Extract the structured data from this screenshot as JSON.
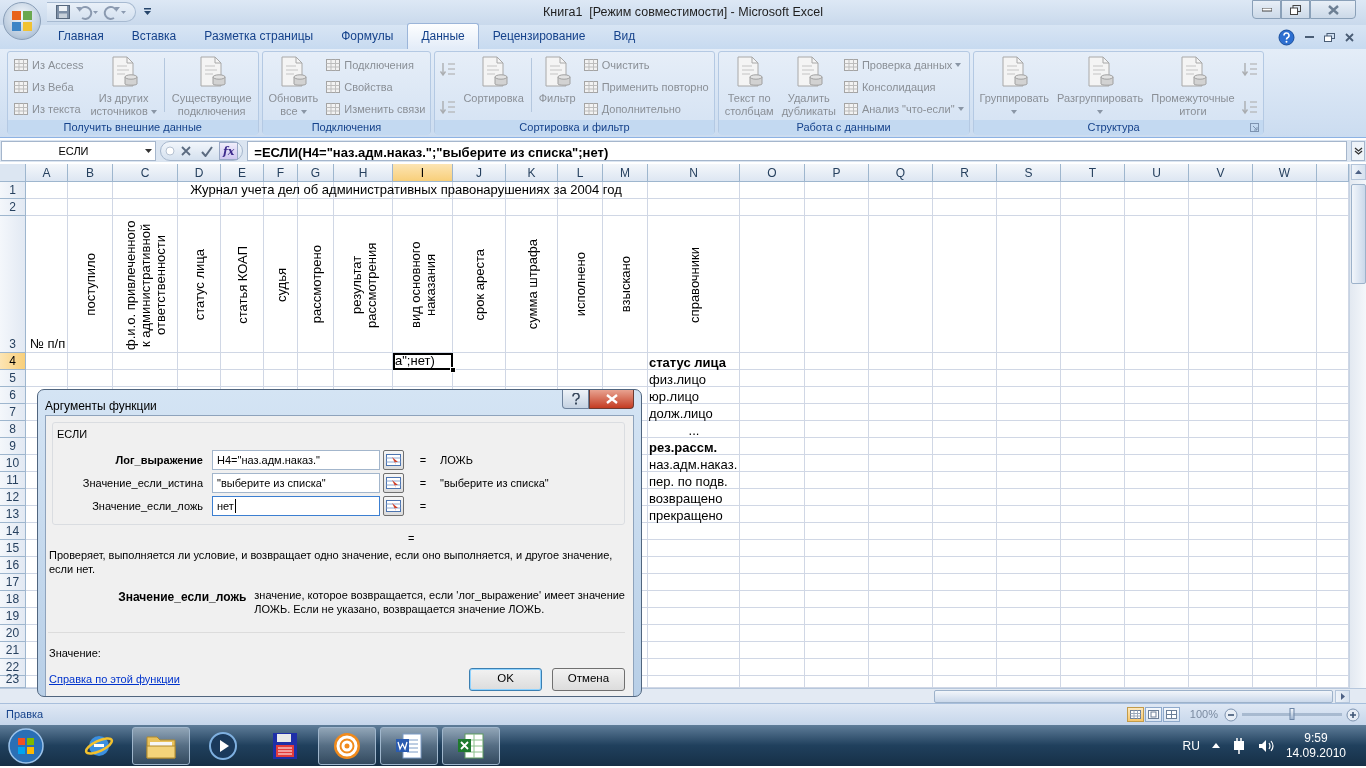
{
  "title_bar": {
    "title": "Книга1  [Режим совместимости] - Microsoft Excel"
  },
  "ribbon": {
    "tabs": [
      {
        "label": "Главная",
        "selected": false
      },
      {
        "label": "Вставка",
        "selected": false
      },
      {
        "label": "Разметка страницы",
        "selected": false
      },
      {
        "label": "Формулы",
        "selected": false
      },
      {
        "label": "Данные",
        "selected": true
      },
      {
        "label": "Рецензирование",
        "selected": false
      },
      {
        "label": "Вид",
        "selected": false
      }
    ],
    "groups": [
      {
        "label": "Получить внешние данные",
        "launcher": false,
        "items": [
          {
            "kind": "small-stack",
            "buttons": [
              {
                "label": "Из Access",
                "disabled": true,
                "dropdown": false
              },
              {
                "label": "Из Веба",
                "disabled": true,
                "dropdown": false
              },
              {
                "label": "Из текста",
                "disabled": true,
                "dropdown": false
              }
            ]
          },
          {
            "kind": "large",
            "lines": [
              "Из других",
              "источников"
            ],
            "disabled": true,
            "dropdown": true
          },
          {
            "kind": "separator"
          },
          {
            "kind": "large",
            "lines": [
              "Существующие",
              "подключения"
            ],
            "disabled": true,
            "dropdown": false
          }
        ]
      },
      {
        "label": "Подключения",
        "launcher": false,
        "items": [
          {
            "kind": "large",
            "lines": [
              "Обновить",
              "все"
            ],
            "disabled": true,
            "dropdown": true
          },
          {
            "kind": "small-stack",
            "buttons": [
              {
                "label": "Подключения",
                "disabled": true,
                "dropdown": false
              },
              {
                "label": "Свойства",
                "disabled": true,
                "dropdown": false
              },
              {
                "label": "Изменить связи",
                "disabled": true,
                "dropdown": false
              }
            ]
          }
        ]
      },
      {
        "label": "Сортировка и фильтр",
        "launcher": false,
        "items": [
          {
            "kind": "icon-stack",
            "buttons": [
              {
                "disabled": true
              },
              {
                "disabled": true
              }
            ]
          },
          {
            "kind": "large",
            "lines": [
              "Сортировка"
            ],
            "disabled": true,
            "dropdown": false
          },
          {
            "kind": "separator"
          },
          {
            "kind": "large",
            "lines": [
              "Фильтр"
            ],
            "disabled": true,
            "dropdown": false
          },
          {
            "kind": "small-stack",
            "buttons": [
              {
                "label": "Очистить",
                "disabled": true,
                "dropdown": false
              },
              {
                "label": "Применить повторно",
                "disabled": true,
                "dropdown": false
              },
              {
                "label": "Дополнительно",
                "disabled": true,
                "dropdown": false
              }
            ]
          }
        ]
      },
      {
        "label": "Работа с данными",
        "launcher": false,
        "items": [
          {
            "kind": "large",
            "lines": [
              "Текст по",
              "столбцам"
            ],
            "disabled": true,
            "dropdown": false
          },
          {
            "kind": "large",
            "lines": [
              "Удалить",
              "дубликаты"
            ],
            "disabled": true,
            "dropdown": false
          },
          {
            "kind": "small-stack",
            "buttons": [
              {
                "label": "Проверка данных",
                "disabled": true,
                "dropdown": true
              },
              {
                "label": "Консолидация",
                "disabled": true,
                "dropdown": false
              },
              {
                "label": "Анализ \"что-если\"",
                "disabled": true,
                "dropdown": true
              }
            ]
          }
        ]
      },
      {
        "label": "Структура",
        "launcher": true,
        "items": [
          {
            "kind": "large",
            "lines": [
              "Группировать"
            ],
            "disabled": true,
            "dropdown": true
          },
          {
            "kind": "large",
            "lines": [
              "Разгруппировать"
            ],
            "disabled": true,
            "dropdown": true
          },
          {
            "kind": "large",
            "lines": [
              "Промежуточные",
              "итоги"
            ],
            "disabled": true,
            "dropdown": false
          },
          {
            "kind": "icon-stack",
            "buttons": [
              {
                "disabled": true
              },
              {
                "disabled": true
              }
            ]
          }
        ]
      }
    ]
  },
  "formula_bar": {
    "name_box": "ЕСЛИ",
    "function_button": "fx",
    "formula": "=ЕСЛИ(H4=\"наз.адм.наказ.\";\"выберите из списка\";нет)"
  },
  "sheet": {
    "columns": [
      {
        "letter": "A",
        "selected": false
      },
      {
        "letter": "B",
        "selected": false
      },
      {
        "letter": "C",
        "selected": false
      },
      {
        "letter": "D",
        "selected": false
      },
      {
        "letter": "E",
        "selected": false
      },
      {
        "letter": "F",
        "selected": false
      },
      {
        "letter": "G",
        "selected": false
      },
      {
        "letter": "H",
        "selected": false
      },
      {
        "letter": "I",
        "selected": true
      },
      {
        "letter": "J",
        "selected": false
      },
      {
        "letter": "K",
        "selected": false
      },
      {
        "letter": "L",
        "selected": false
      },
      {
        "letter": "M",
        "selected": false
      },
      {
        "letter": "N",
        "selected": false
      },
      {
        "letter": "O",
        "selected": false
      },
      {
        "letter": "P",
        "selected": false
      },
      {
        "letter": "Q",
        "selected": false
      },
      {
        "letter": "R",
        "selected": false
      },
      {
        "letter": "S",
        "selected": false
      },
      {
        "letter": "T",
        "selected": false
      },
      {
        "letter": "U",
        "selected": false
      },
      {
        "letter": "V",
        "selected": false
      },
      {
        "letter": "W",
        "selected": false
      }
    ],
    "rows": [
      {
        "number": "1",
        "selected": false
      },
      {
        "number": "2",
        "selected": false
      },
      {
        "number": "3",
        "selected": false
      },
      {
        "number": "4",
        "selected": true
      },
      {
        "number": "5",
        "selected": false
      },
      {
        "number": "6",
        "selected": false
      },
      {
        "number": "7",
        "selected": false
      },
      {
        "number": "8",
        "selected": false
      },
      {
        "number": "9",
        "selected": false
      },
      {
        "number": "10",
        "selected": false
      },
      {
        "number": "11",
        "selected": false
      },
      {
        "number": "12",
        "selected": false
      },
      {
        "number": "13",
        "selected": false
      },
      {
        "number": "14",
        "selected": false
      },
      {
        "number": "15",
        "selected": false
      },
      {
        "number": "16",
        "selected": false
      },
      {
        "number": "17",
        "selected": false
      },
      {
        "number": "18",
        "selected": false
      },
      {
        "number": "19",
        "selected": false
      },
      {
        "number": "20",
        "selected": false
      },
      {
        "number": "21",
        "selected": false
      },
      {
        "number": "22",
        "selected": false
      },
      {
        "number": "23",
        "selected": false
      }
    ],
    "title": "Журнал учета дел об административных правонарушениях за 2004 год",
    "header_row": [
      {
        "text": "№ п/п",
        "kind": "horizontal"
      },
      {
        "text": "поступило",
        "kind": "vertical"
      },
      {
        "text": "ф.и.о. привлеченного к административной ответственности",
        "kind": "vertical"
      },
      {
        "text": "статус лица",
        "kind": "vertical"
      },
      {
        "text": "статья КОАП",
        "kind": "vertical"
      },
      {
        "text": "судья",
        "kind": "vertical"
      },
      {
        "text": "рассмотрено",
        "kind": "vertical"
      },
      {
        "text": "результат рассмотрения",
        "kind": "vertical"
      },
      {
        "text": "вид основного наказания",
        "kind": "vertical"
      },
      {
        "text": "срок ареста",
        "kind": "vertical"
      },
      {
        "text": "сумма штрафа",
        "kind": "vertical"
      },
      {
        "text": "исполнено",
        "kind": "vertical"
      },
      {
        "text": "взыскано",
        "kind": "vertical"
      },
      {
        "text": "справочники",
        "kind": "vertical"
      }
    ],
    "active_cell": {
      "text": "а\";нет)"
    },
    "reference_list": [
      {
        "text": "статус лица",
        "kind": "heading"
      },
      {
        "text": "физ.лицо",
        "kind": "item"
      },
      {
        "text": "юр.лицо",
        "kind": "item"
      },
      {
        "text": "долж.лицо",
        "kind": "item"
      },
      {
        "text": "...",
        "kind": "ellipsis"
      },
      {
        "text": "рез.рассм.",
        "kind": "heading"
      },
      {
        "text": "наз.адм.наказ.",
        "kind": "item"
      },
      {
        "text": "пер. по подв.",
        "kind": "item"
      },
      {
        "text": "возвращено",
        "kind": "item"
      },
      {
        "text": "прекращено",
        "kind": "item"
      }
    ]
  },
  "dialog": {
    "title": "Аргументы функции",
    "function_name": "ЕСЛИ",
    "arguments": [
      {
        "label": "Лог_выражение",
        "required": true,
        "value": "H4=\"наз.адм.наказ.\"",
        "focused": false,
        "sign": "=",
        "result": "ЛОЖЬ"
      },
      {
        "label": "Значение_если_истина",
        "required": false,
        "value": "\"выберите из списка\"",
        "focused": false,
        "sign": "=",
        "result": "\"выберите из списка\""
      },
      {
        "label": "Значение_если_ложь",
        "required": false,
        "value": "нет",
        "focused": true,
        "sign": "="
      }
    ],
    "formula_sign": "=",
    "description": "Проверяет, выполняется ли условие, и возвращает одно значение, если оно выполняется, и другое значение, если нет.",
    "argument_help": {
      "name": "Значение_если_ложь",
      "text": "значение, которое возвращается, если 'лог_выражение' имеет значение ЛОЖЬ. Если не указано, возвращается значение ЛОЖЬ."
    },
    "value_label": "Значение:",
    "help_link": "Справка по этой функции",
    "buttons": [
      {
        "label": "OK",
        "default": true
      },
      {
        "label": "Отмена",
        "default": false
      }
    ]
  },
  "status_bar": {
    "mode": "Правка",
    "view_buttons": [
      {
        "selected": true
      },
      {
        "selected": false
      },
      {
        "selected": false
      }
    ],
    "zoom": "100%",
    "zoom_slider": {
      "level": 0.5
    }
  },
  "taskbar": {
    "apps": [
      {
        "running": false
      },
      {
        "running": true
      },
      {
        "running": false
      },
      {
        "running": false
      },
      {
        "running": true
      },
      {
        "running": true
      },
      {
        "running": true
      }
    ],
    "language": "RU",
    "time": "9:59",
    "date": "14.09.2010"
  }
}
